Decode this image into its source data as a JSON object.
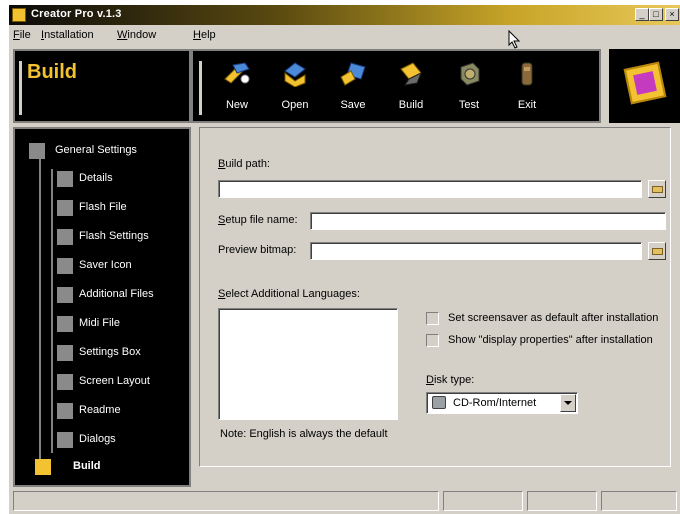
{
  "window": {
    "title": "Creator Pro v.1.3"
  },
  "menu": [
    {
      "label": "File",
      "u": "F",
      "rest": "ile"
    },
    {
      "label": "Installation",
      "u": "I",
      "rest": "nstallation"
    },
    {
      "label": "Window",
      "u": "W",
      "rest": "indow"
    },
    {
      "label": "Help",
      "u": "H",
      "rest": "elp"
    }
  ],
  "header": {
    "section_title": "Build"
  },
  "toolbar": [
    {
      "label": "New",
      "icon": "new-icon"
    },
    {
      "label": "Open",
      "icon": "open-icon"
    },
    {
      "label": "Save",
      "icon": "save-icon"
    },
    {
      "label": "Build",
      "icon": "build-icon"
    },
    {
      "label": "Test",
      "icon": "test-icon"
    },
    {
      "label": "Exit",
      "icon": "exit-icon"
    }
  ],
  "nav": {
    "items": [
      {
        "label": "General Settings",
        "level": 0
      },
      {
        "label": "Details",
        "level": 1
      },
      {
        "label": "Flash File",
        "level": 1
      },
      {
        "label": "Flash Settings",
        "level": 1
      },
      {
        "label": "Saver Icon",
        "level": 1
      },
      {
        "label": "Additional Files",
        "level": 1
      },
      {
        "label": "Midi File",
        "level": 1
      },
      {
        "label": "Settings Box",
        "level": 1
      },
      {
        "label": "Screen Layout",
        "level": 1
      },
      {
        "label": "Readme",
        "level": 1
      },
      {
        "label": "Dialogs",
        "level": 1
      },
      {
        "label": "Build",
        "level": 0,
        "active": true
      }
    ]
  },
  "form": {
    "build_path": {
      "label_u": "B",
      "label_rest": "uild path:",
      "value": ""
    },
    "setup_file": {
      "label_u": "S",
      "label_rest": "etup file name:",
      "value": ""
    },
    "preview": {
      "label": "Preview bitmap:",
      "value": ""
    },
    "languages": {
      "label_u": "S",
      "label_rest": "elect Additional Languages:",
      "note": "Note: English is always the default"
    },
    "check_default": {
      "label": "Set screensaver as default after installation",
      "checked": false
    },
    "check_display": {
      "label": "Show \"display properties\" after installation",
      "checked": false
    },
    "disk_type": {
      "label_u": "D",
      "label_rest": "isk type:",
      "value": "CD-Rom/Internet"
    }
  }
}
